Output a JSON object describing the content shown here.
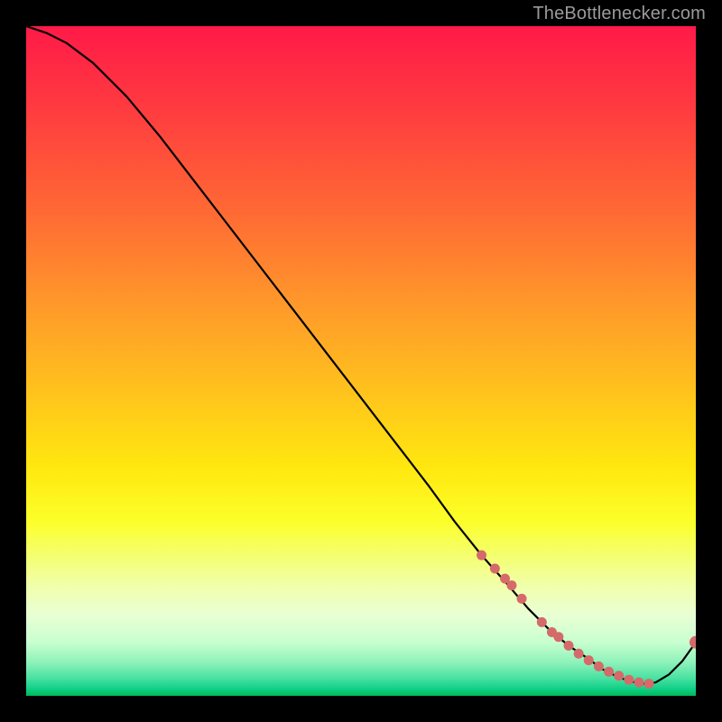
{
  "watermark": "TheBottlenecker.com",
  "chart_data": {
    "type": "line",
    "title": "",
    "xlabel": "",
    "ylabel": "",
    "xlim": [
      0,
      100
    ],
    "ylim": [
      0,
      100
    ],
    "grid": false,
    "series": [
      {
        "name": "curve",
        "x": [
          0,
          3,
          6,
          10,
          15,
          20,
          25,
          30,
          35,
          40,
          45,
          50,
          55,
          60,
          64,
          68,
          72,
          75,
          78,
          81,
          84,
          86,
          88,
          90,
          92,
          94,
          96,
          98,
          100
        ],
        "y": [
          100,
          99,
          97.5,
          94.5,
          89.5,
          83.5,
          77,
          70.5,
          64,
          57.5,
          51,
          44.5,
          38,
          31.5,
          26,
          21,
          16.5,
          13,
          10,
          7.5,
          5.5,
          4,
          3,
          2.2,
          1.8,
          2,
          3.2,
          5.2,
          8
        ]
      }
    ],
    "markers": {
      "name": "highlighted-points",
      "x": [
        68,
        70,
        71.5,
        72.5,
        74,
        77,
        78.5,
        79.5,
        81,
        82.5,
        84,
        85.5,
        87,
        88.5,
        90,
        91.5,
        93,
        100
      ],
      "y": [
        21,
        19,
        17.5,
        16.5,
        14.5,
        11,
        9.5,
        8.8,
        7.5,
        6.3,
        5.3,
        4.4,
        3.6,
        3,
        2.4,
        2,
        1.8,
        8
      ],
      "r_default": 5.5,
      "r_overrides": {
        "17": 7
      }
    },
    "colors": {
      "curve": "#000000",
      "marker": "#d56a6a",
      "gradient_top": "#ff1a48",
      "gradient_bottom": "#00b85a"
    }
  }
}
